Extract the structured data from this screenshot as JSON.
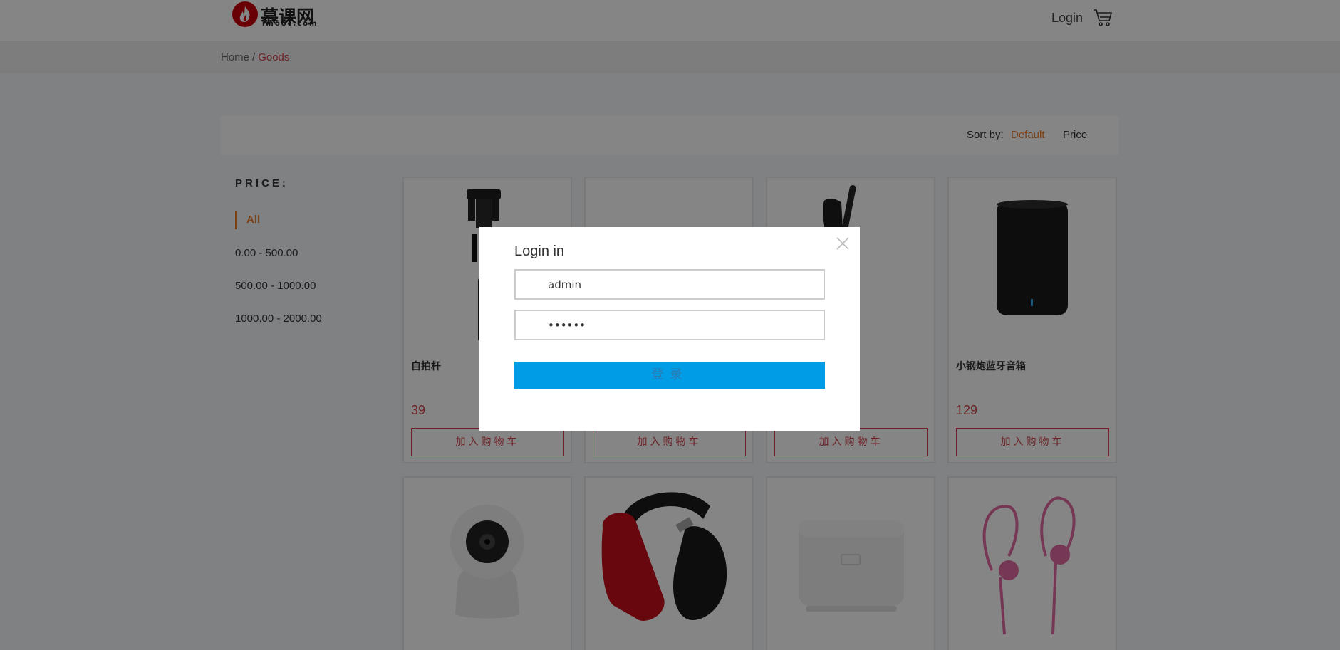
{
  "header": {
    "logo_main": "慕课网",
    "logo_sub": "imooc.com",
    "login_label": "Login"
  },
  "breadcrumb": {
    "home": "Home",
    "separator": "/",
    "current": "Goods"
  },
  "sort": {
    "label": "Sort by:",
    "options": [
      "Default",
      "Price"
    ],
    "active": "Default"
  },
  "filter": {
    "title": "PRICE:",
    "items": [
      "All",
      "0.00 - 500.00",
      "500.00 - 1000.00",
      "1000.00 - 2000.00"
    ],
    "active": "All"
  },
  "products": [
    {
      "name": "自拍杆",
      "price": "39",
      "button": "加入购物车",
      "image": "selfie-stick"
    },
    {
      "name": "",
      "price": "",
      "button": "加入购物车",
      "image": "hidden"
    },
    {
      "name": "",
      "price": "",
      "button": "加入购物车",
      "image": "earpiece"
    },
    {
      "name": "小钢炮蓝牙音箱",
      "price": "129",
      "button": "加入购物车",
      "image": "bluetooth-speaker"
    },
    {
      "image": "security-camera"
    },
    {
      "image": "headphones"
    },
    {
      "image": "rice-cooker"
    },
    {
      "image": "earphones"
    }
  ],
  "modal": {
    "title": "Login in",
    "username": "admin",
    "password": "••••••",
    "submit_label": "登录"
  },
  "colors": {
    "accent": "#ee7a23",
    "brand_red": "#d1434b",
    "login_button": "#009de6"
  }
}
